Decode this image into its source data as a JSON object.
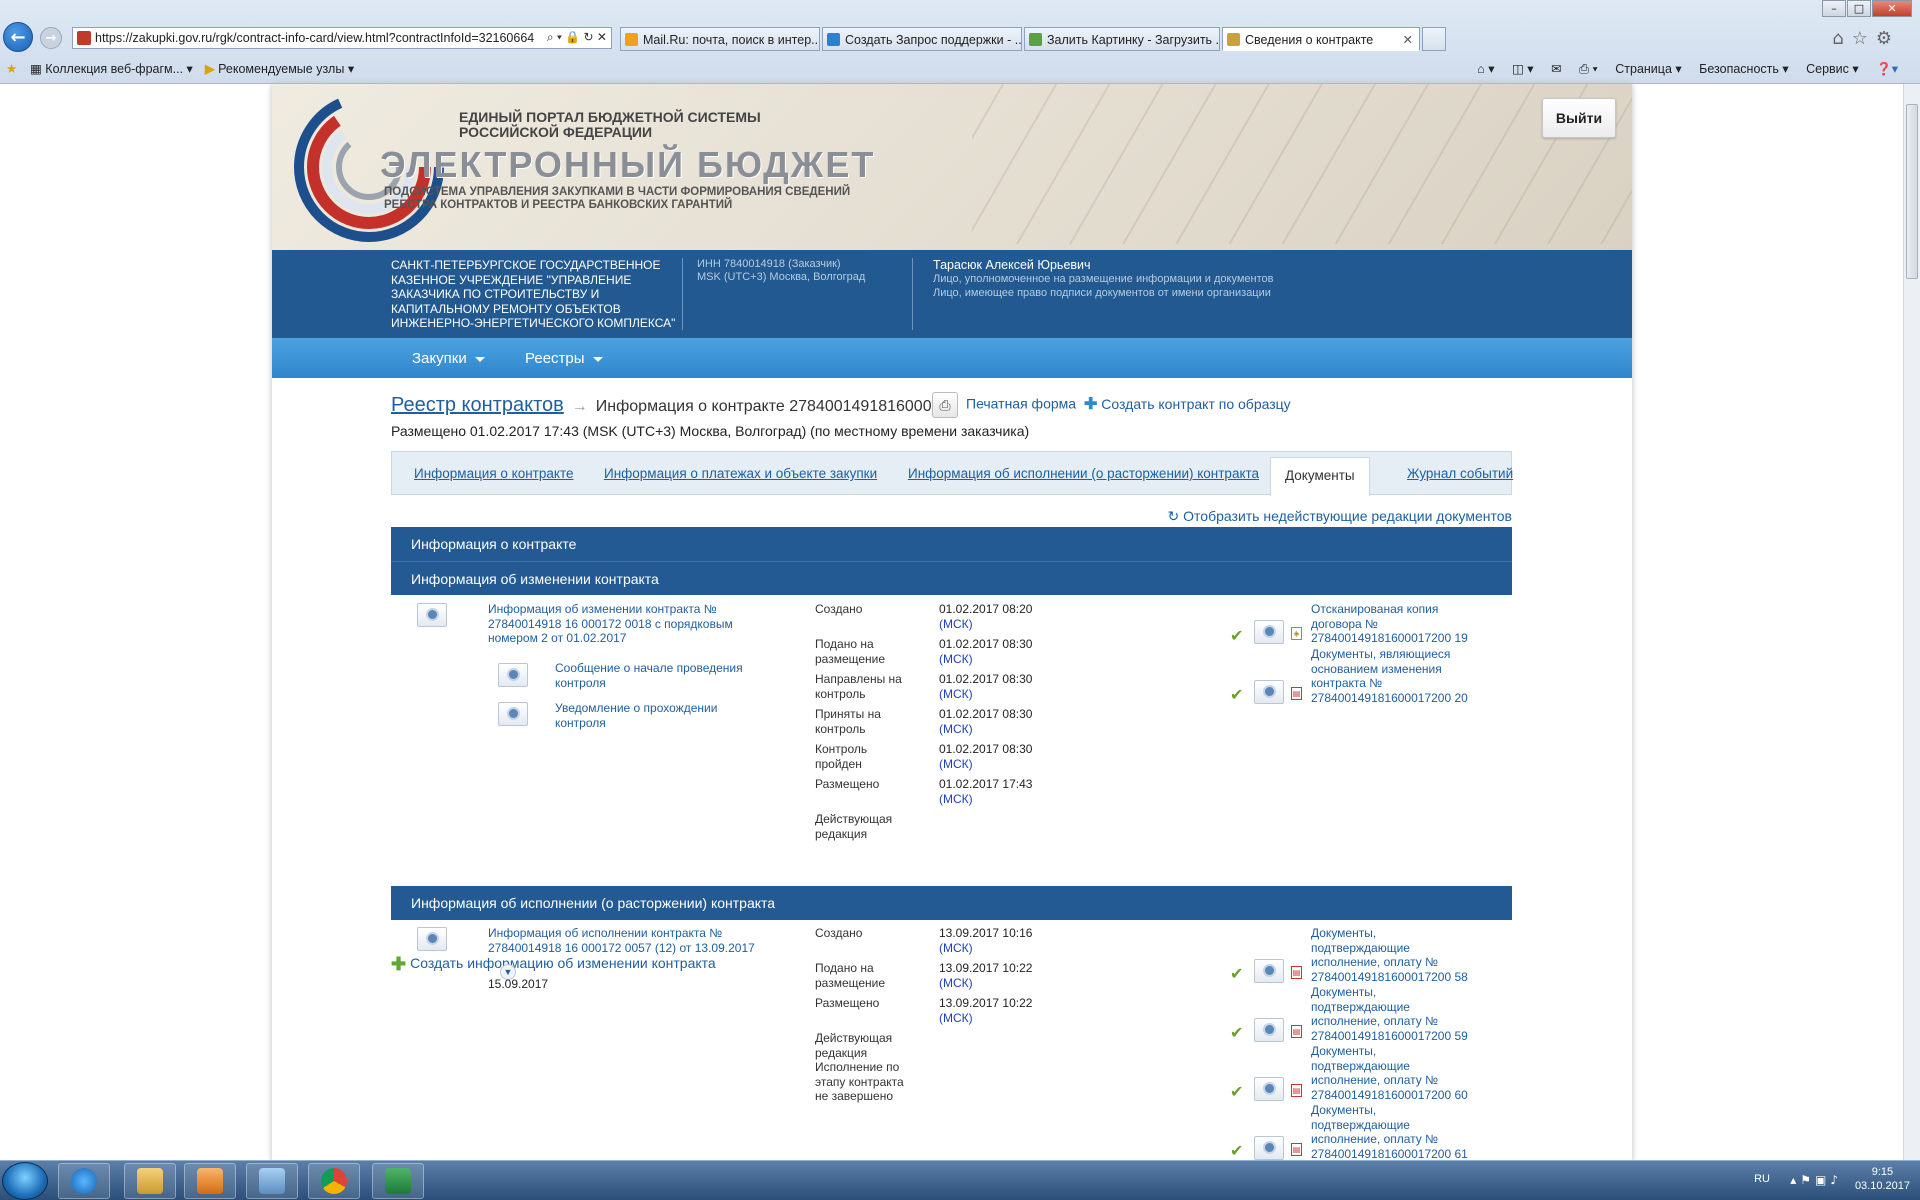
{
  "browser": {
    "url": "https://zakupki.gov.ru/rgk/contract-info-card/view.html?contractInfoId=32160664",
    "tabs": [
      {
        "title": "Mail.Ru: почта, поиск в интер...",
        "icon_color": "#f0a020"
      },
      {
        "title": "Создать Запрос поддержки - ...",
        "icon_color": "#2e7fd0"
      },
      {
        "title": "Залить Картинку - Загрузить ...",
        "icon_color": "#5aa040"
      },
      {
        "title": "Сведения о контракте",
        "icon_color": "#c8a23a",
        "active": true
      }
    ],
    "favorites": [
      "Коллекция веб-фрагм...",
      "Рекомендуемые узлы"
    ],
    "commands": [
      "Страница ▾",
      "Безопасность ▾",
      "Сервис ▾"
    ]
  },
  "banner": {
    "top_line1": "ЕДИНЫЙ ПОРТАЛ БЮДЖЕТНОЙ СИСТЕМЫ",
    "top_line2": "РОССИЙСКОЙ ФЕДЕРАЦИИ",
    "title": "ЭЛЕКТРОННЫЙ БЮДЖЕТ",
    "sub_line1": "ПОДСИСТЕМА УПРАВЛЕНИЯ ЗАКУПКАМИ В ЧАСТИ ФОРМИРОВАНИЯ СВЕДЕНИЙ",
    "sub_line2": "РЕЕСТРА КОНТРАКТОВ И РЕЕСТРА БАНКОВСКИХ ГАРАНТИЙ",
    "logout": "Выйти"
  },
  "org": {
    "name": "САНКТ-ПЕТЕРБУРГСКОЕ ГОСУДАРСТВЕННОЕ КАЗЕННОЕ УЧРЕЖДЕНИЕ \"УПРАВЛЕНИЕ ЗАКАЗЧИКА ПО СТРОИТЕЛЬСТВУ И КАПИТАЛЬНОМУ РЕМОНТУ ОБЪЕКТОВ ИНЖЕНЕРНО-ЭНЕРГЕТИЧЕСКОГО КОМПЛЕКСА\"",
    "inn": "ИНН 7840014918 (Заказчик)",
    "tz": "MSK (UTC+3) Москва, Волгоград",
    "user_name": "Тарасюк Алексей Юрьевич",
    "role1": "Лицо, уполномоченное на размещение информации и документов",
    "role2": "Лицо, имеющее право подписи документов от имени организации"
  },
  "menu": [
    "Закупки",
    "Реестры"
  ],
  "crumbs": {
    "root": "Реестр контрактов",
    "current": "Информация о контракте 2784001491816000172"
  },
  "placed": "Размещено 01.02.2017 17:43 (MSK (UTC+3) Москва, Волгоград) (по местному времени заказчика)",
  "actions": {
    "print": "Печатная форма",
    "create": "Создать контракт по образцу"
  },
  "page_tabs": [
    "Информация о контракте",
    "Информация о платежах и объекте закупки",
    "Информация об исполнении (о расторжении) контракта",
    "Документы",
    "Журнал событий"
  ],
  "show_inactive": "Отобразить недействующие редакции документов",
  "sections": {
    "contract_info": "Информация о контракте",
    "change_info": "Информация об изменении контракта",
    "execution_info": "Информация об исполнении (о расторжении) контракта"
  },
  "change_doc": {
    "title1": "Информация об изменении контракта №",
    "title2": "27840014918 16 000172 0018 с порядковым",
    "title3": "номером 2 от 01.02.2017",
    "sub1a": "Сообщение о начале проведения",
    "sub1b": "контроля",
    "sub2a": "Уведомление о прохождении",
    "sub2b": "контроля",
    "statuses": [
      {
        "l1": "Создано",
        "l2": "",
        "date": "01.02.2017 08:20"
      },
      {
        "l1": "Подано на",
        "l2": "размещение",
        "date": "01.02.2017 08:30"
      },
      {
        "l1": "Направлены на",
        "l2": "контроль",
        "date": "01.02.2017 08:30"
      },
      {
        "l1": "Приняты на",
        "l2": "контроль",
        "date": "01.02.2017 08:30"
      },
      {
        "l1": "Контроль",
        "l2": "пройден",
        "date": "01.02.2017 08:30"
      },
      {
        "l1": "Размещено",
        "l2": "",
        "date": "01.02.2017 17:43"
      },
      {
        "l1": "Действующая",
        "l2": "редакция",
        "date": ""
      }
    ],
    "msk": "(МСК)",
    "files": [
      {
        "l1": "Отсканированая копия",
        "l2": "договора №",
        "l3": "278400149181600017200 19"
      },
      {
        "l1": "Документы, являющиеся",
        "l2": "основанием изменения",
        "l3": "контракта №",
        "l4": "278400149181600017200 20"
      }
    ]
  },
  "add_change": "Создать информацию об изменении контракта",
  "exec_doc": {
    "title1": "Информация об исполнении контракта №",
    "title2": "27840014918 16 000172 0057 (12) от 13.09.2017",
    "date": "15.09.2017",
    "statuses": [
      {
        "l1": "Создано",
        "l2": "",
        "date": "13.09.2017 10:16"
      },
      {
        "l1": "Подано на",
        "l2": "размещение",
        "date": "13.09.2017 10:22"
      },
      {
        "l1": "Размещено",
        "l2": "",
        "date": "13.09.2017 10:22"
      }
    ],
    "note1": "Действующая",
    "note2": "редакция",
    "note3": "Исполнение по",
    "note4": "этапу контракта",
    "note5": "не завершено",
    "file_l1": "Документы,",
    "file_l2": "подтверждающие",
    "file_l3": "исполнение, оплату №",
    "file_nums": [
      "278400149181600017200 58",
      "278400149181600017200 59",
      "278400149181600017200 60",
      "278400149181600017200 61"
    ]
  },
  "tray": {
    "lang": "RU",
    "time": "9:15",
    "date": "03.10.2017"
  }
}
